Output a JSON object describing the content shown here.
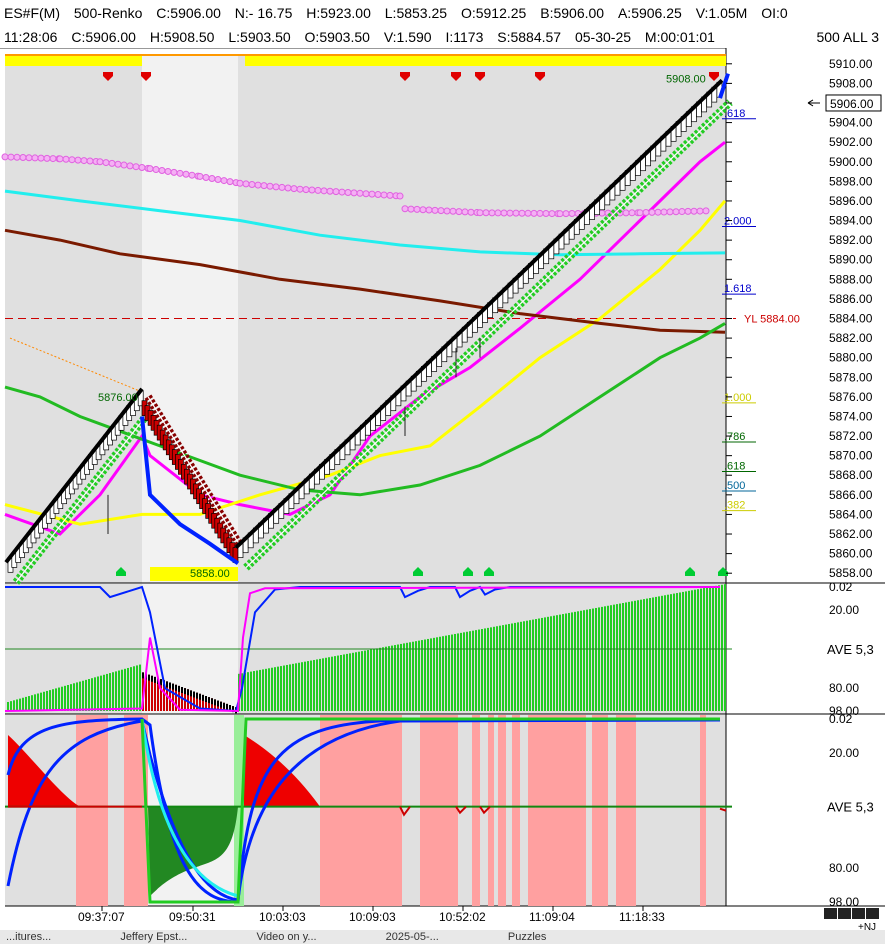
{
  "header": {
    "row1": [
      "ES#F(M)",
      "500-Renko",
      "C:5906.00",
      "N:- 16.75",
      "H:5923.00",
      "L:5853.25",
      "O:5912.25",
      "B:5906.00",
      "A:5906.25",
      "V:1.05M",
      "OI:0"
    ],
    "row2": [
      "11:28:06",
      "C:5906.00",
      "H:5908.50",
      "L:5903.50",
      "O:5903.50",
      "V:1.590",
      "I:1173",
      "S:5884.57",
      "05-30-25",
      "M:00:01:01"
    ],
    "row2_right": "500 ALL 3"
  },
  "taskbar": {
    "items": [
      "...itures...",
      "Jeffery Epst...",
      "Video on y...",
      "2025-05-...",
      "Puzzles"
    ]
  },
  "colors": {
    "background": "#e0e0e0",
    "highlight_band": "#f2f2f2",
    "renko_up": "#ffffff",
    "renko_down": "#cc0000",
    "trail_green": "#22cc22",
    "line_magenta": "#ff00ff",
    "line_yellow": "#ffff00",
    "line_cyan": "#22eeee",
    "line_brown": "#7a1a00",
    "line_green": "#22bb22",
    "line_blue": "#0022ff",
    "alert_red": "#e00000",
    "alert_green": "#00cc33",
    "pink_fill": "#ffa0a0"
  },
  "chart_data": [
    {
      "type": "line",
      "panel": "price",
      "ylim": [
        5857,
        5911
      ],
      "yticks": [
        5858,
        5860,
        5862,
        5864,
        5866,
        5868,
        5870,
        5872,
        5874,
        5876,
        5878,
        5880,
        5882,
        5884,
        5886,
        5888,
        5890,
        5892,
        5894,
        5896,
        5898,
        5900,
        5902,
        5904,
        5906,
        5908,
        5910
      ],
      "last_price_label": "5906.00",
      "yl_line": {
        "label": "YL 5884.00",
        "value": 5884.0
      },
      "fib_labels": [
        {
          "text": ".618",
          "value": 5905.0,
          "color": "#0000cc"
        },
        {
          "text": "2.000",
          "value": 5894.0,
          "color": "#0000cc"
        },
        {
          "text": "1.618",
          "value": 5887.1,
          "color": "#0000cc"
        },
        {
          "text": "1.000",
          "value": 5876.0,
          "color": "#cccc00"
        },
        {
          "text": ".786",
          "value": 5872.0,
          "color": "#006600"
        },
        {
          "text": ".618",
          "value": 5869.0,
          "color": "#006600"
        },
        {
          "text": ".500",
          "value": 5867.0,
          "color": "#006699"
        },
        {
          "text": ".382",
          "value": 5865.0,
          "color": "#cccc00"
        }
      ],
      "price_annotations": [
        {
          "text": "5876.00",
          "x": 142,
          "value": 5876.0,
          "color": "#006600"
        },
        {
          "text": "5858.00",
          "x": 234,
          "value": 5858.0,
          "color": "#006600"
        },
        {
          "text": "5908.00",
          "x": 710,
          "value": 5908.5,
          "color": "#006600"
        }
      ],
      "renko": {
        "segments": [
          {
            "from": {
              "x": 8,
              "y": 5858.5
            },
            "to": {
              "x": 142,
              "y": 5876.0
            },
            "direction": "up"
          },
          {
            "from": {
              "x": 142,
              "y": 5875.0
            },
            "to": {
              "x": 236,
              "y": 5859.5
            },
            "direction": "down"
          },
          {
            "from": {
              "x": 238,
              "y": 5860.0
            },
            "to": {
              "x": 722,
              "y": 5907.5
            },
            "direction": "up"
          }
        ]
      },
      "series": [
        {
          "color": "#ff00ff",
          "points": [
            [
              5,
              5864
            ],
            [
              60,
              5862
            ],
            [
              100,
              5866
            ],
            [
              142,
              5872
            ],
            [
              150,
              5870
            ],
            [
              200,
              5866
            ],
            [
              240,
              5865
            ],
            [
              290,
              5864
            ],
            [
              330,
              5866
            ],
            [
              370,
              5872
            ],
            [
              420,
              5876
            ],
            [
              470,
              5879
            ],
            [
              520,
              5883
            ],
            [
              580,
              5888
            ],
            [
              640,
              5894
            ],
            [
              700,
              5900
            ],
            [
              725,
              5902
            ]
          ]
        },
        {
          "color": "#ffff00",
          "points": [
            [
              5,
              5865
            ],
            [
              80,
              5863
            ],
            [
              142,
              5864
            ],
            [
              200,
              5864
            ],
            [
              260,
              5866
            ],
            [
              330,
              5868
            ],
            [
              380,
              5870
            ],
            [
              430,
              5871
            ],
            [
              480,
              5875
            ],
            [
              540,
              5880
            ],
            [
              600,
              5884
            ],
            [
              660,
              5889
            ],
            [
              700,
              5893
            ],
            [
              725,
              5896
            ]
          ]
        },
        {
          "color": "#22eeee",
          "points": [
            [
              5,
              5897
            ],
            [
              80,
              5896
            ],
            [
              160,
              5895
            ],
            [
              240,
              5894
            ],
            [
              320,
              5892.5
            ],
            [
              400,
              5891.5
            ],
            [
              480,
              5890.8
            ],
            [
              560,
              5890.5
            ],
            [
              640,
              5890.6
            ],
            [
              725,
              5890.7
            ]
          ]
        },
        {
          "color": "#7a1a00",
          "points": [
            [
              5,
              5893
            ],
            [
              60,
              5892
            ],
            [
              120,
              5890.6
            ],
            [
              200,
              5889.5
            ],
            [
              280,
              5888
            ],
            [
              360,
              5887
            ],
            [
              440,
              5885.8
            ],
            [
              520,
              5884.5
            ],
            [
              600,
              5883.5
            ],
            [
              660,
              5882.8
            ],
            [
              725,
              5882.6
            ]
          ]
        },
        {
          "color": "#22bb22",
          "points": [
            [
              5,
              5877
            ],
            [
              40,
              5876
            ],
            [
              80,
              5874
            ],
            [
              120,
              5872.5
            ],
            [
              160,
              5871
            ],
            [
              200,
              5869.5
            ],
            [
              240,
              5868
            ],
            [
              300,
              5866.5
            ],
            [
              360,
              5866
            ],
            [
              420,
              5867
            ],
            [
              480,
              5869
            ],
            [
              540,
              5872
            ],
            [
              600,
              5876
            ],
            [
              660,
              5880
            ],
            [
              700,
              5882
            ],
            [
              725,
              5883.5
            ]
          ]
        }
      ],
      "dotted_series": {
        "color": "#e060e0",
        "points": [
          [
            5,
            5900.5
          ],
          [
            60,
            5900.3
          ],
          [
            100,
            5900
          ],
          [
            150,
            5899.3
          ],
          [
            200,
            5898.5
          ],
          [
            240,
            5897.8
          ],
          [
            300,
            5897.2
          ],
          [
            400,
            5896.5
          ],
          [
            405,
            5895.2
          ],
          [
            480,
            5894.8
          ],
          [
            560,
            5894.7
          ],
          [
            640,
            5894.8
          ],
          [
            712,
            5895
          ]
        ]
      },
      "blue_down_line": [
        [
          142,
          5874
        ],
        [
          150,
          5866
        ],
        [
          180,
          5863
        ],
        [
          210,
          5861
        ],
        [
          238,
          5859
        ]
      ],
      "top_alerts": [
        108,
        146,
        405,
        456,
        480,
        540,
        714
      ],
      "bottom_alerts": [
        121,
        418,
        468,
        489,
        690,
        723
      ]
    },
    {
      "type": "line",
      "panel": "oscillator_1",
      "yticks_labels": [
        "0.02",
        "20.00",
        "80.00",
        "98.00"
      ],
      "ave_label": "AVE 5,3",
      "series": [
        {
          "name": "",
          "color": "#0022ff",
          "points": [
            [
              5,
              0
            ],
            [
              100,
              0
            ],
            [
              110,
              8
            ],
            [
              130,
              3
            ],
            [
              142,
              0
            ],
            [
              150,
              20
            ],
            [
              165,
              80
            ],
            [
              200,
              96
            ],
            [
              236,
              98
            ],
            [
              242,
              80
            ],
            [
              255,
              20
            ],
            [
              275,
              2
            ],
            [
              300,
              0
            ],
            [
              400,
              0
            ],
            [
              405,
              8
            ],
            [
              418,
              3
            ],
            [
              430,
              0
            ],
            [
              455,
              0
            ],
            [
              460,
              8
            ],
            [
              470,
              3
            ],
            [
              480,
              0
            ],
            [
              485,
              6
            ],
            [
              495,
              2
            ],
            [
              510,
              0
            ],
            [
              720,
              0
            ]
          ]
        },
        {
          "name": "",
          "color": "#ff00ff",
          "points": [
            [
              5,
              98
            ],
            [
              142,
              96
            ],
            [
              150,
              40
            ],
            [
              160,
              80
            ],
            [
              180,
              97
            ],
            [
              238,
              98
            ],
            [
              243,
              40
            ],
            [
              250,
              5
            ],
            [
              265,
              1
            ],
            [
              720,
              0
            ]
          ]
        }
      ]
    },
    {
      "type": "line",
      "panel": "oscillator_2",
      "yticks_labels": [
        "0.02",
        "20.00",
        "80.00",
        "98.00"
      ],
      "ave_label": "AVE 5,3",
      "pink_bands": [
        [
          76,
          108
        ],
        [
          124,
          142
        ],
        [
          142,
          148
        ],
        [
          320,
          402
        ],
        [
          420,
          458
        ],
        [
          472,
          480
        ],
        [
          488,
          494
        ],
        [
          498,
          506
        ],
        [
          512,
          520
        ],
        [
          528,
          586
        ],
        [
          592,
          608
        ],
        [
          616,
          636
        ],
        [
          700,
          706
        ]
      ]
    }
  ],
  "x_time_labels": [
    {
      "text": "09:37:07",
      "x": 102
    },
    {
      "text": "09:50:31",
      "x": 193
    },
    {
      "text": "10:03:03",
      "x": 283
    },
    {
      "text": "10:09:03",
      "x": 373
    },
    {
      "text": "10:52:02",
      "x": 463
    },
    {
      "text": "11:09:04",
      "x": 553
    },
    {
      "text": "11:18:33",
      "x": 643
    }
  ],
  "nav_label": "+NJ"
}
